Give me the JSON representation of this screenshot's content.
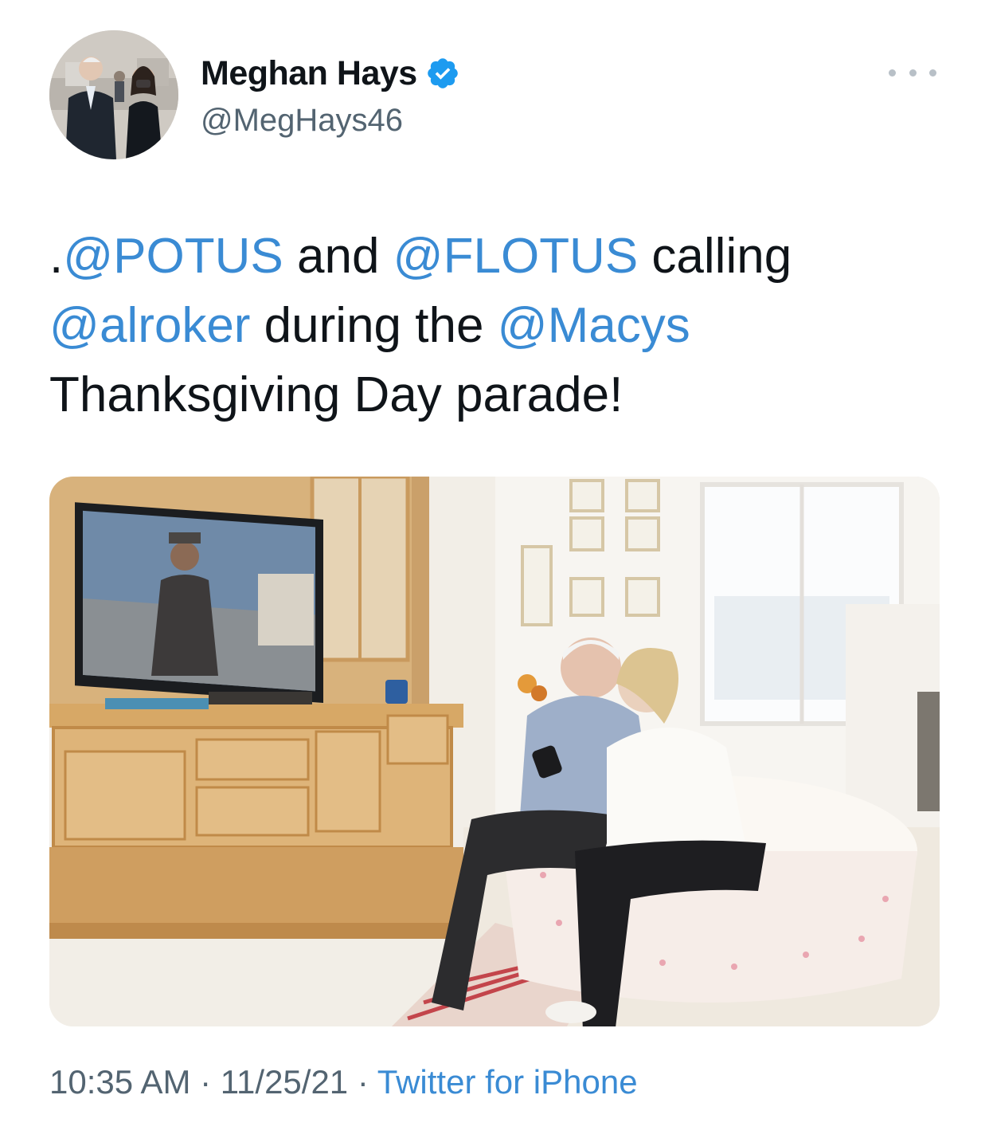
{
  "author": {
    "display_name": "Meghan Hays",
    "handle": "@MegHays46",
    "verified": true,
    "verified_icon": "verified-badge-icon"
  },
  "tweet": {
    "text_segments": [
      {
        "text": ".",
        "type": "plain"
      },
      {
        "text": "@POTUS",
        "type": "mention"
      },
      {
        "text": " and ",
        "type": "plain"
      },
      {
        "text": "@FLOTUS",
        "type": "mention"
      },
      {
        "text": " calling ",
        "type": "plain"
      },
      {
        "text": "@alroker",
        "type": "mention"
      },
      {
        "text": " during the ",
        "type": "plain"
      },
      {
        "text": "@Macys",
        "type": "mention"
      },
      {
        "text": " Thanksgiving Day parade!",
        "type": "plain"
      }
    ]
  },
  "media": {
    "kind": "photo"
  },
  "footer": {
    "time": "10:35 AM",
    "separator": " · ",
    "date": "11/25/21",
    "source": "Twitter for iPhone"
  },
  "menu": {
    "icon": "more-options-icon"
  },
  "colors": {
    "link": "#3a8bd4",
    "text": "#0f1419",
    "secondary": "#536471",
    "verified": "#1d9bf0"
  }
}
